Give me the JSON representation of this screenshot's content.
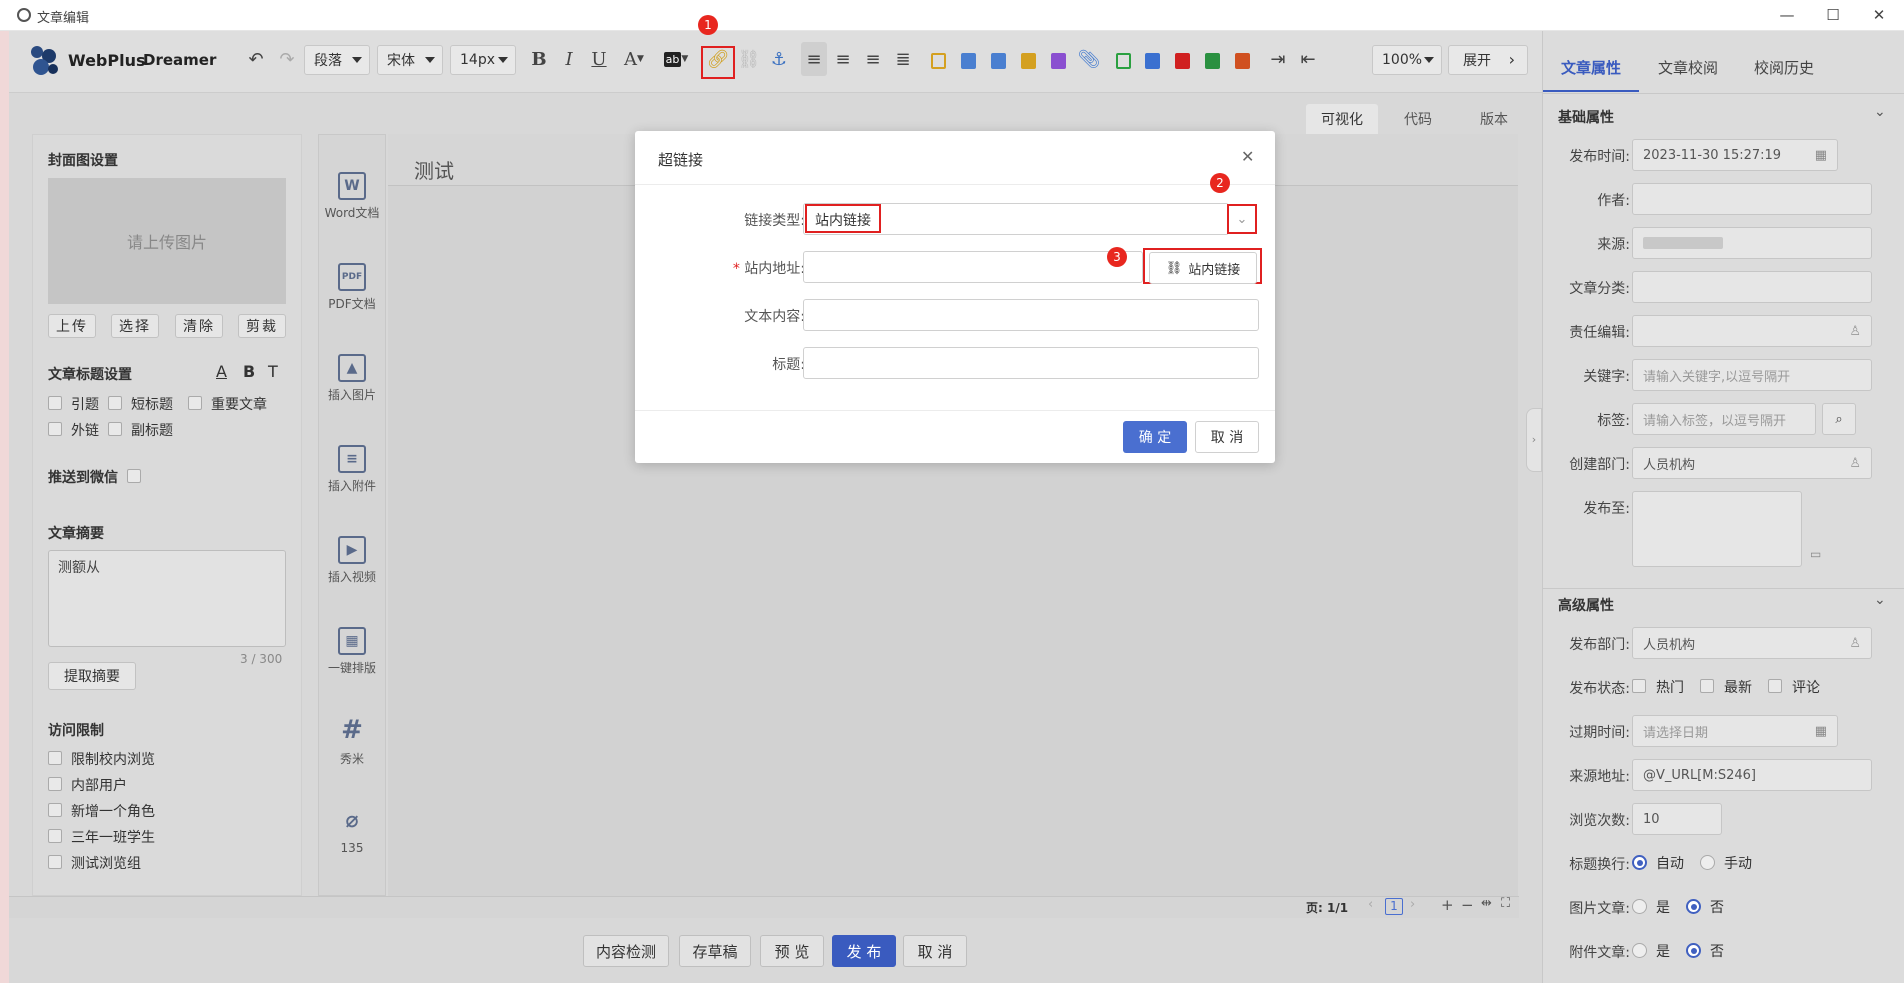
{
  "window": {
    "title": "文章编辑",
    "minimize": "—",
    "maximize": "☐",
    "close": "✕"
  },
  "app": {
    "name": "WebPlus",
    "sub": "Dreamer"
  },
  "toolbar": {
    "paragraph": "段落",
    "font": "宋体",
    "size": "14px",
    "zoom": "100%",
    "expand": "展开",
    "bold": "B",
    "italic": "I",
    "underline": "U",
    "fontcolor": "A",
    "highlight": "ab"
  },
  "annotations": {
    "b1": "1",
    "b2": "2",
    "b3": "3"
  },
  "editor_tabs": [
    "可视化",
    "代码",
    "版本"
  ],
  "left": {
    "cover_title": "封面图设置",
    "cover_placeholder": "请上传图片",
    "cover_buttons": [
      "上传",
      "选择",
      "清除",
      "剪裁"
    ],
    "title_settings": "文章标题设置",
    "title_fmt": [
      "A",
      "B",
      "T"
    ],
    "title_opts": [
      "引题",
      "短标题",
      "重要文章",
      "外链",
      "副标题"
    ],
    "wechat": "推送到微信",
    "summary_title": "文章摘要",
    "summary_text": "测额从",
    "summary_count": "3 / 300",
    "extract_btn": "提取摘要",
    "access_title": "访问限制",
    "access_opts": [
      "限制校内浏览",
      "内部用户",
      "新增一个角色",
      "三年一班学生",
      "测试浏览组"
    ]
  },
  "icons_col": [
    {
      "glyph": "W",
      "label": "Word文档"
    },
    {
      "glyph": "PDF",
      "label": "PDF文档"
    },
    {
      "glyph": "▲",
      "label": "插入图片"
    },
    {
      "glyph": "≡",
      "label": "插入附件"
    },
    {
      "glyph": "▶",
      "label": "插入视频"
    },
    {
      "glyph": "▦",
      "label": "一键排版"
    },
    {
      "glyph": "#",
      "label": "秀米"
    },
    {
      "glyph": "⌀",
      "label": "135"
    }
  ],
  "editor": {
    "title": "测试"
  },
  "status": {
    "page": "页: 1/1",
    "cur": "1"
  },
  "bottom": {
    "check": "内容检测",
    "draft": "存草稿",
    "preview": "预 览",
    "publish": "发 布",
    "cancel": "取 消"
  },
  "right": {
    "tabs": [
      "文章属性",
      "文章校阅",
      "校阅历史"
    ],
    "basic": "基础属性",
    "advanced": "高级属性",
    "fields": {
      "publish_time_l": "发布时间:",
      "publish_time_v": "2023-11-30 15:27:19",
      "author_l": "作者:",
      "source_l": "来源:",
      "category_l": "文章分类:",
      "editor_l": "责任编辑:",
      "keywords_l": "关键字:",
      "keywords_ph": "请输入关键字,以逗号隔开",
      "tags_l": "标签:",
      "tags_ph": "请输入标签，以逗号隔开",
      "dept_l": "创建部门:",
      "dept_v": "人员机构",
      "pubto_l": "发布至:",
      "pubdept_l": "发布部门:",
      "pubdept_v": "人员机构",
      "status_l": "发布状态:",
      "status_opts": [
        "热门",
        "最新",
        "评论"
      ],
      "expire_l": "过期时间:",
      "expire_ph": "请选择日期",
      "srcurl_l": "来源地址:",
      "srcurl_v": "@V_URL[M:S246]",
      "views_l": "浏览次数:",
      "views_v": "10",
      "wrap_l": "标题换行:",
      "wrap_auto": "自动",
      "wrap_manual": "手动",
      "img_l": "图片文章:",
      "yes": "是",
      "no": "否",
      "att_l": "附件文章:"
    }
  },
  "modal": {
    "title": "超链接",
    "type_l": "链接类型:",
    "type_v": "站内链接",
    "addr_l": "站内地址:",
    "addr_btn": "站内链接",
    "text_l": "文本内容:",
    "title_l": "标题:",
    "ok": "确 定",
    "cancel": "取 消",
    "close": "✕"
  },
  "colors": {
    "accent": "#4a6fd0",
    "annotation": "#e8271f"
  }
}
